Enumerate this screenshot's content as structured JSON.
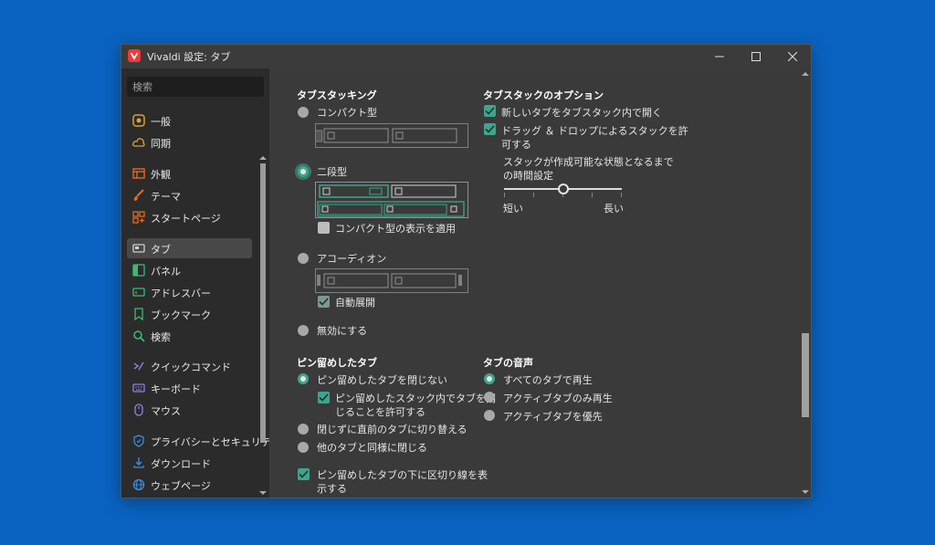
{
  "window": {
    "title": "Vivaldi 設定: タブ",
    "controls": [
      "minimize-icon",
      "maximize-icon",
      "close-icon"
    ]
  },
  "sidebar": {
    "search_placeholder": "検索",
    "items": [
      {
        "label": "一般",
        "icon": "general-icon",
        "color": "#e0a030"
      },
      {
        "label": "同期",
        "icon": "cloud-icon",
        "color": "#e0a030"
      },
      {
        "label": "外観",
        "icon": "appearance-icon",
        "color": "#e86820"
      },
      {
        "label": "テーマ",
        "icon": "brush-icon",
        "color": "#e86820"
      },
      {
        "label": "スタートページ",
        "icon": "grid-icon",
        "color": "#e86820"
      },
      {
        "label": "タブ",
        "icon": "tab-icon",
        "color": "#d0d0d0",
        "active": true
      },
      {
        "label": "パネル",
        "icon": "panel-icon",
        "color": "#3dba74"
      },
      {
        "label": "アドレスバー",
        "icon": "address-bar-icon",
        "color": "#3dba74"
      },
      {
        "label": "ブックマーク",
        "icon": "bookmark-icon",
        "color": "#3dba74"
      },
      {
        "label": "検索",
        "icon": "magnifier-icon",
        "color": "#3dba74"
      },
      {
        "label": "クイックコマンド",
        "icon": "command-icon",
        "color": "#9a7ee0"
      },
      {
        "label": "キーボード",
        "icon": "keyboard-icon",
        "color": "#9a7ee0"
      },
      {
        "label": "マウス",
        "icon": "mouse-icon",
        "color": "#9a7ee0"
      },
      {
        "label": "プライバシーとセキュリティ",
        "icon": "shield-icon",
        "color": "#3a8ee0"
      },
      {
        "label": "ダウンロード",
        "icon": "download-icon",
        "color": "#3a8ee0"
      },
      {
        "label": "ウェブページ",
        "icon": "globe-icon",
        "color": "#3a8ee0"
      }
    ]
  },
  "tab_stacking": {
    "heading": "タブスタッキング",
    "compact": "コンパクト型",
    "two_level": "二段型",
    "two_level_compact": "コンパクト型の表示を適用",
    "accordion": "アコーディオン",
    "auto_expand": "自動展開",
    "disabled": "無効にする",
    "selected": "二段型"
  },
  "stack_options": {
    "heading": "タブスタックのオプション",
    "open_new_in_stack": "新しいタブをタブスタック内で開く",
    "drag_drop_line1": "ドラッグ ＆ ドロップによるスタックを許",
    "drag_drop_line2": "可する",
    "delay_line1": "スタックが作成可能な状態となるまで",
    "delay_line2": "の時間設定",
    "short": "短い",
    "long": "長い",
    "delay_level": 0.5
  },
  "pinned_tabs": {
    "heading": "ピン留めしたタブ",
    "dont_close": "ピン留めしたタブを閉じない",
    "allow_in_stack_line1": "ピン留めしたスタック内でタブを閉",
    "allow_in_stack_line2": "じることを許可する",
    "switch_prev": "閉じずに直前のタブに切り替える",
    "close_like_others": "他のタブと同様に閉じる",
    "divider_line1": "ピン留めしたタブの下に区切り線を表",
    "divider_line2": "示する"
  },
  "tab_audio": {
    "heading": "タブの音声",
    "all_tabs": "すべてのタブで再生",
    "active_only": "アクティブタブのみ再生",
    "prefer_active": "アクティブタブを優先"
  },
  "colors": {
    "accent": "#3da58e",
    "window_bg": "#3a3a3a",
    "sidebar_bg": "#2b2b2b",
    "desktop_bg": "#0a63c0"
  }
}
